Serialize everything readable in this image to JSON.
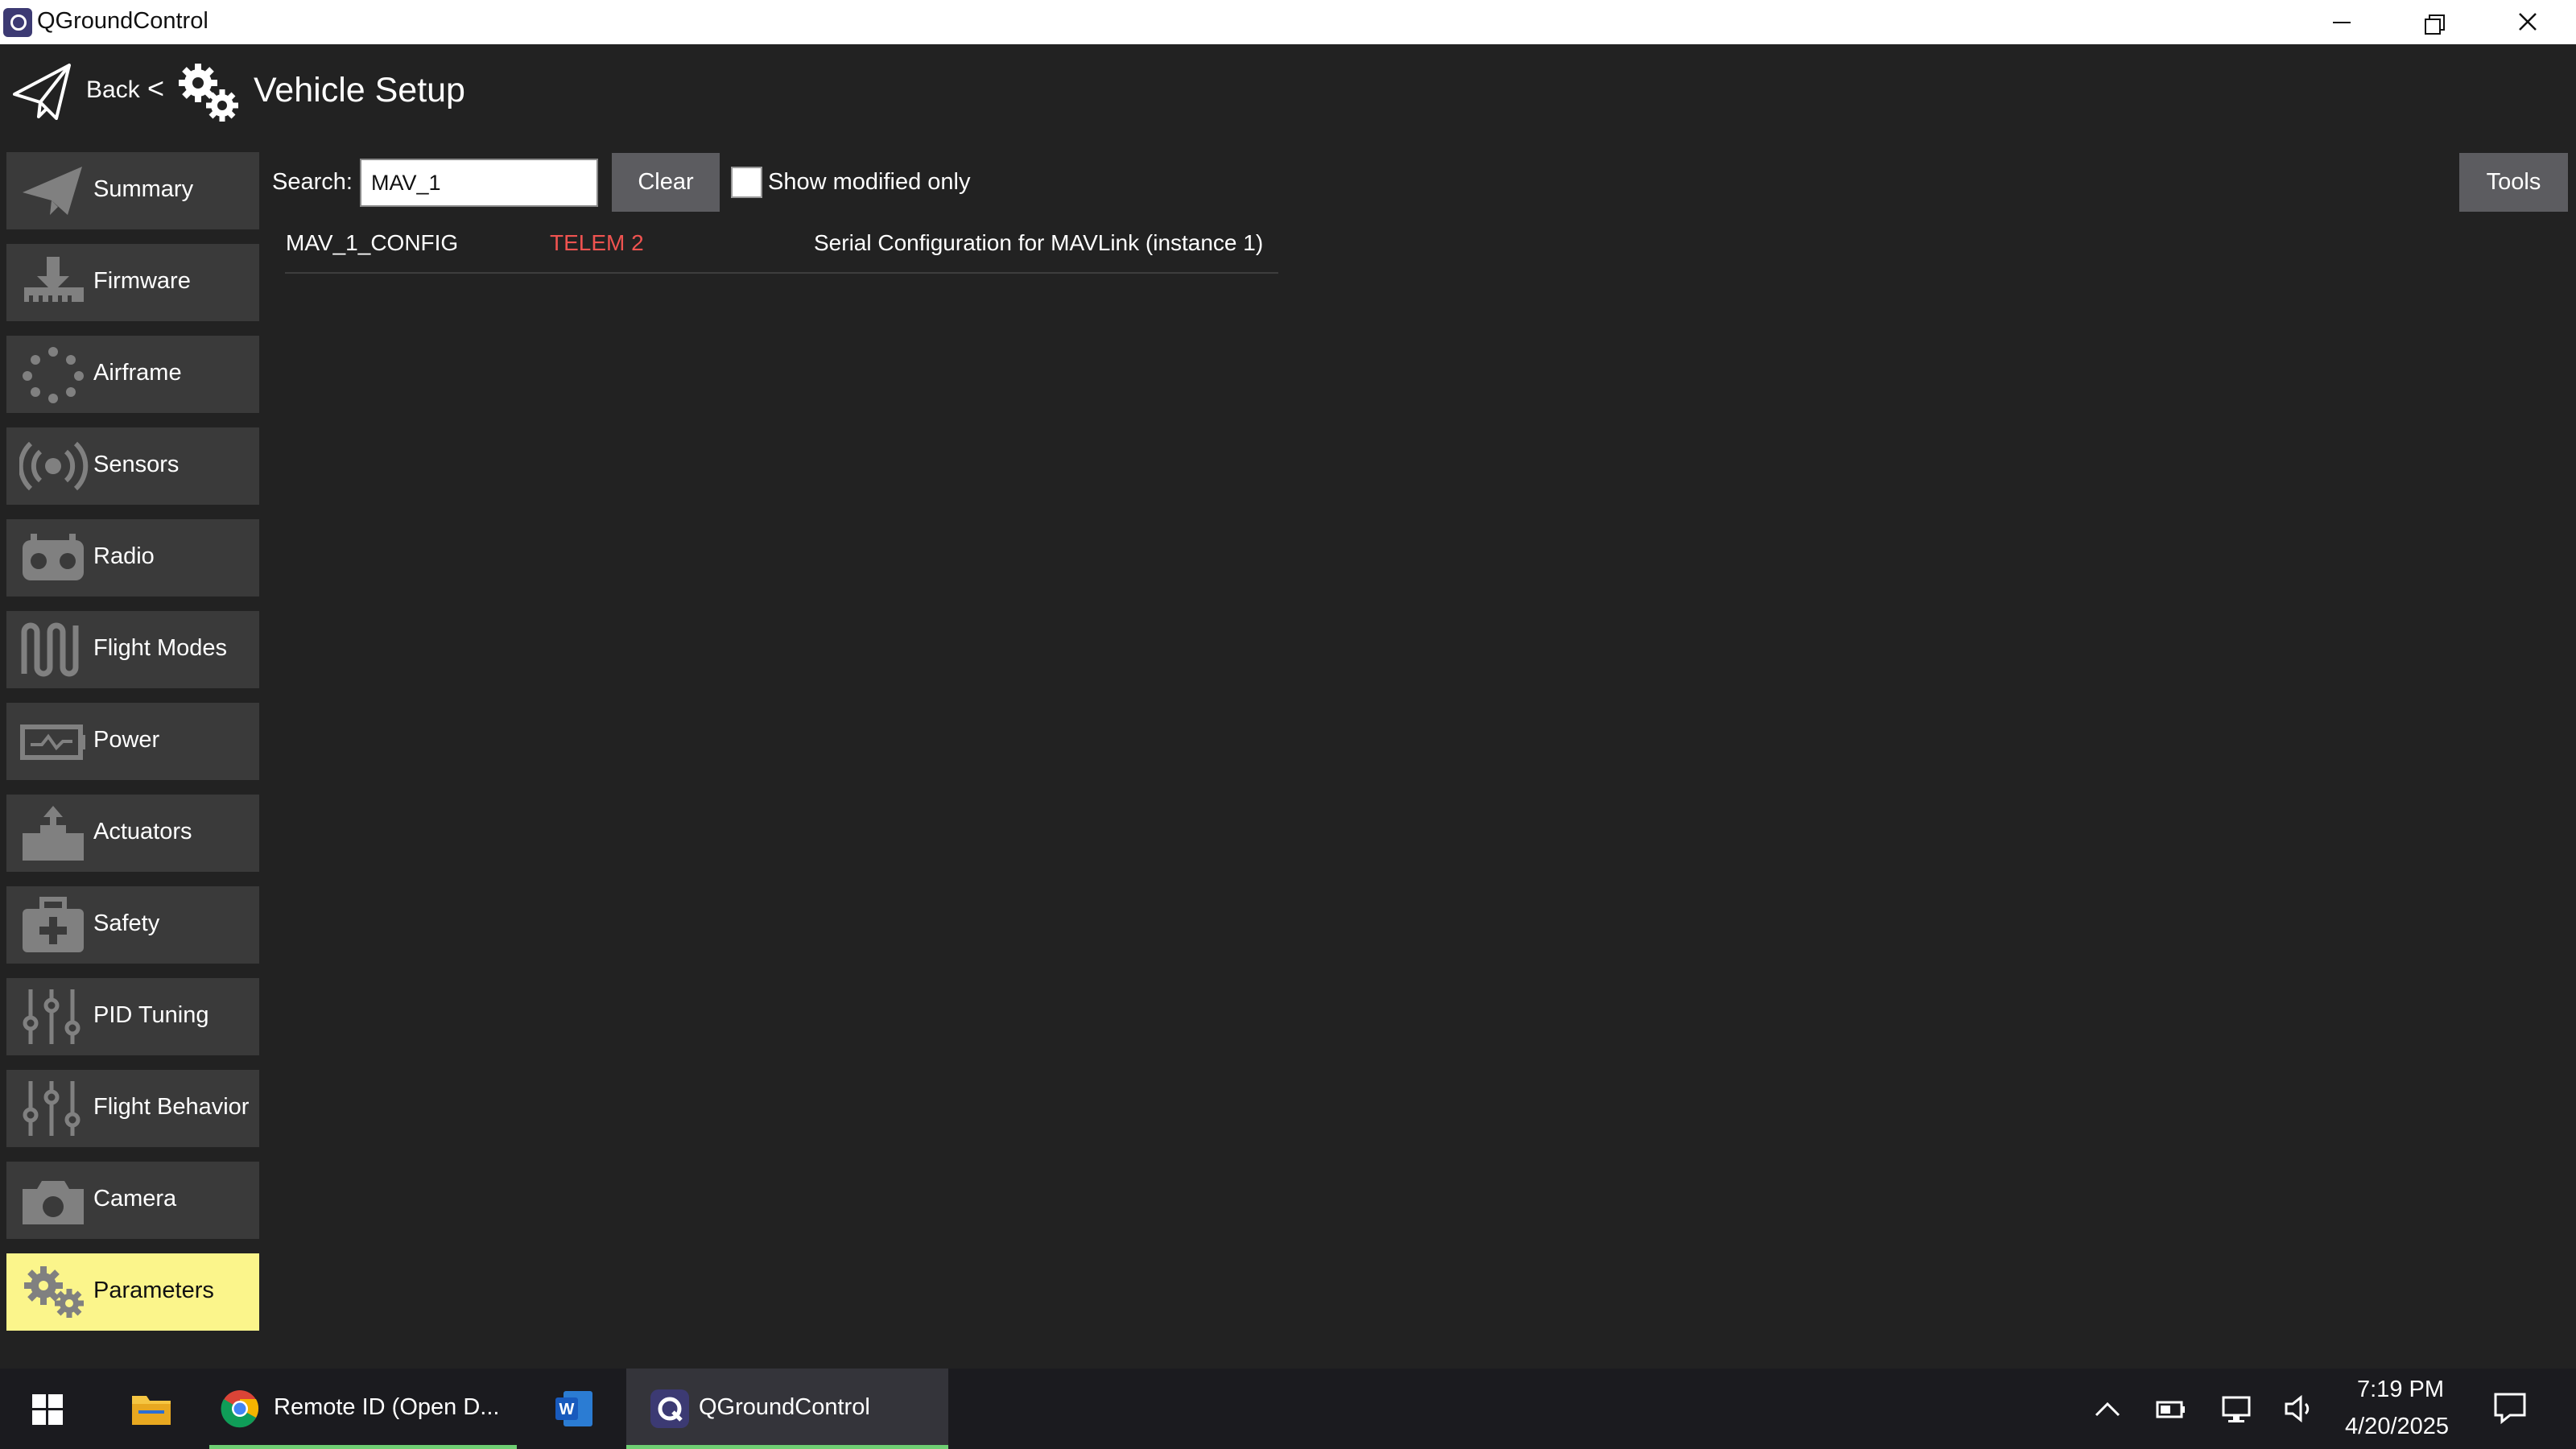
{
  "window": {
    "title": "QGroundControl"
  },
  "header": {
    "back_label": "Back",
    "separator": "<",
    "title": "Vehicle Setup"
  },
  "sidebar": {
    "items": [
      {
        "label": "Summary",
        "icon": "paper-plane-icon"
      },
      {
        "label": "Firmware",
        "icon": "download-icon"
      },
      {
        "label": "Airframe",
        "icon": "airframe-icon"
      },
      {
        "label": "Sensors",
        "icon": "sensors-icon"
      },
      {
        "label": "Radio",
        "icon": "radio-icon"
      },
      {
        "label": "Flight Modes",
        "icon": "wave-icon"
      },
      {
        "label": "Power",
        "icon": "battery-icon"
      },
      {
        "label": "Actuators",
        "icon": "actuator-icon"
      },
      {
        "label": "Safety",
        "icon": "first-aid-icon"
      },
      {
        "label": "PID Tuning",
        "icon": "sliders-icon"
      },
      {
        "label": "Flight Behavior",
        "icon": "sliders-icon"
      },
      {
        "label": "Camera",
        "icon": "camera-icon"
      },
      {
        "label": "Parameters",
        "icon": "gears-icon",
        "active": true
      }
    ]
  },
  "search": {
    "label": "Search:",
    "value": "MAV_1",
    "clear_label": "Clear",
    "modified_only_label": "Show modified only",
    "modified_only_checked": false
  },
  "tools_label": "Tools",
  "params": [
    {
      "name": "MAV_1_CONFIG",
      "value": "TELEM 2",
      "description": "Serial Configuration for MAVLink (instance 1)"
    }
  ],
  "taskbar": {
    "items": [
      {
        "label": "Remote ID (Open D...",
        "icon": "chrome-icon"
      },
      {
        "label": "QGroundControl",
        "icon": "qgc-icon"
      }
    ],
    "time": "7:19 PM",
    "date": "4/20/2025"
  },
  "colors": {
    "accent": "#fbf58b",
    "value_modified": "#ef5350",
    "background": "#222222",
    "button": "#5c5c60"
  }
}
